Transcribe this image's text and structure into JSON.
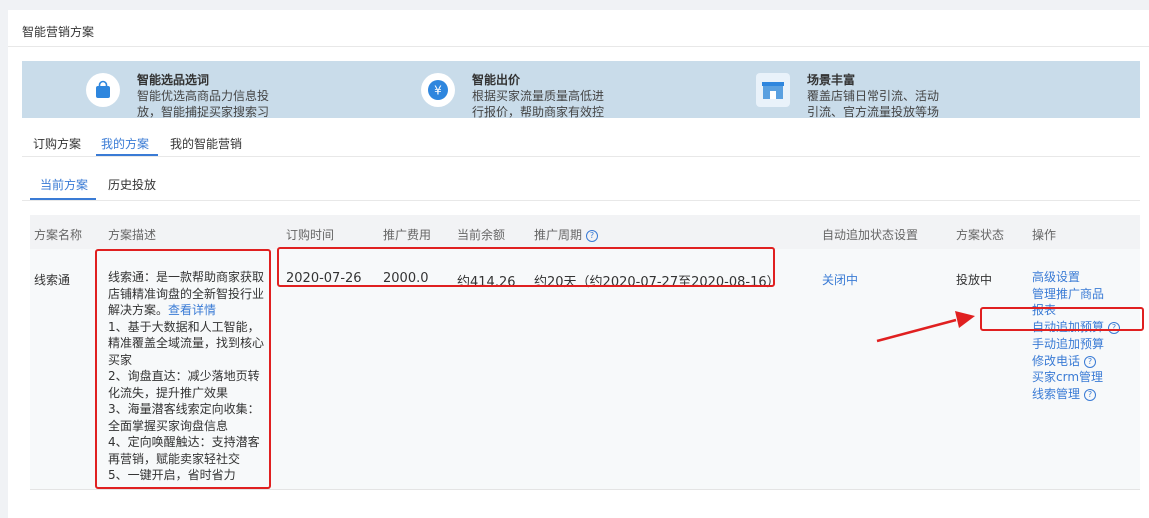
{
  "page": {
    "title": "智能营销方案"
  },
  "banner": {
    "features": [
      {
        "title": "智能选品选词",
        "desc": "智能优选高商品力信息投放，智能捕捉买家搜索习惯",
        "icon": "shopping-bag-icon"
      },
      {
        "title": "智能出价",
        "desc": "根据买家流量质量高低进行报价，帮助商家有效控制成本",
        "icon": "yen-coin-icon"
      },
      {
        "title": "场景丰富",
        "desc": "覆盖店铺日常引流、活动引流、官方流量投放等场景",
        "icon": "store-icon"
      }
    ]
  },
  "tabs_primary": [
    "订购方案",
    "我的方案",
    "我的智能营销"
  ],
  "tabs_secondary": [
    "当前方案",
    "历史投放"
  ],
  "table": {
    "headers": [
      "方案名称",
      "方案描述",
      "订购时间",
      "推广费用",
      "当前余额",
      "推广周期",
      "自动追加状态设置",
      "方案状态",
      "操作"
    ],
    "row": {
      "name": "线索通",
      "desc_intro": "线索通：是一款帮助商家获取店铺精准询盘的全新智投行业解决方案。",
      "desc_link": "查看详情",
      "desc_points": [
        "1、基于大数据和人工智能，精准覆盖全域流量，找到核心买家",
        "2、询盘直达：减少落地页转化流失，提升推广效果",
        "3、海量潜客线索定向收集：全面掌握买家询盘信息",
        "4、定向唤醒触达：支持潜客再营销，赋能卖家轻社交",
        "5、一键开启，省时省力"
      ],
      "order_time": "2020-07-26",
      "fee": "2000.0",
      "balance": "约414.26",
      "period": "约20天（约2020-07-27至2020-08-16）",
      "auto_status": "关闭中",
      "status": "投放中",
      "operations": [
        "高级设置",
        "管理推广商品",
        "报表",
        "自动追加预算",
        "手动追加预算",
        "修改电话",
        "买家crm管理",
        "线索管理"
      ]
    }
  },
  "colors": {
    "accent": "#3a7bd5",
    "annotation": "#e02020",
    "banner_bg": "#c9dcea"
  }
}
